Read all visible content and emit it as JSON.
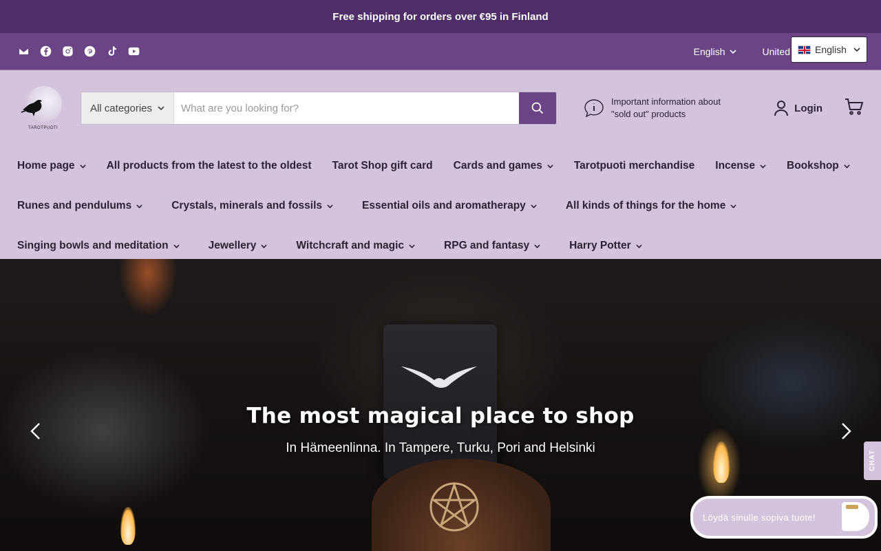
{
  "announcement": "Free shipping for orders over €95 in Finland",
  "social_icons": [
    "email-icon",
    "facebook-icon",
    "instagram-icon",
    "pinterest-icon",
    "tiktok-icon",
    "youtube-icon"
  ],
  "utility": {
    "language": "English",
    "country": "United",
    "lang_widget": "English"
  },
  "logo": {
    "text": "TAROTPUOTI"
  },
  "search": {
    "category": "All categories",
    "placeholder": "What are you looking for?"
  },
  "info": {
    "line1": "Important information about",
    "line2": "\"sold out\" products"
  },
  "login": "Login",
  "nav": {
    "row1": [
      {
        "label": "Home page",
        "has_dropdown": true
      },
      {
        "label": "All products from the latest to the oldest",
        "has_dropdown": false
      },
      {
        "label": "Tarot Shop gift card",
        "has_dropdown": false
      },
      {
        "label": "Cards and games",
        "has_dropdown": true
      },
      {
        "label": "Tarotpuoti merchandise",
        "has_dropdown": false
      },
      {
        "label": "Incense",
        "has_dropdown": true
      },
      {
        "label": "Bookshop",
        "has_dropdown": true
      }
    ],
    "row2": [
      {
        "label": "Runes and pendulums",
        "has_dropdown": true
      },
      {
        "label": "Crystals, minerals and fossils",
        "has_dropdown": true
      },
      {
        "label": "Essential oils and aromatherapy",
        "has_dropdown": true
      },
      {
        "label": "All kinds of things for the home",
        "has_dropdown": true
      }
    ],
    "row3": [
      {
        "label": "Singing bowls and meditation",
        "has_dropdown": true
      },
      {
        "label": "Jewellery",
        "has_dropdown": true
      },
      {
        "label": "Witchcraft and magic",
        "has_dropdown": true
      },
      {
        "label": "RPG and fantasy",
        "has_dropdown": true
      },
      {
        "label": "Harry Potter",
        "has_dropdown": true
      }
    ]
  },
  "hero": {
    "title": "The most magical place to shop",
    "subtitle": "In Hämeenlinna. In Tampere, Turku, Pori and Helsinki"
  },
  "chat": {
    "tab": "CHAT",
    "bubble": "Löydä sinulle sopiva tuote!"
  },
  "colors": {
    "announcement_bg": "#4f2d69",
    "utility_bg": "#6a4485",
    "header_bg": "#d4c3dc",
    "search_button": "#6a4485"
  }
}
